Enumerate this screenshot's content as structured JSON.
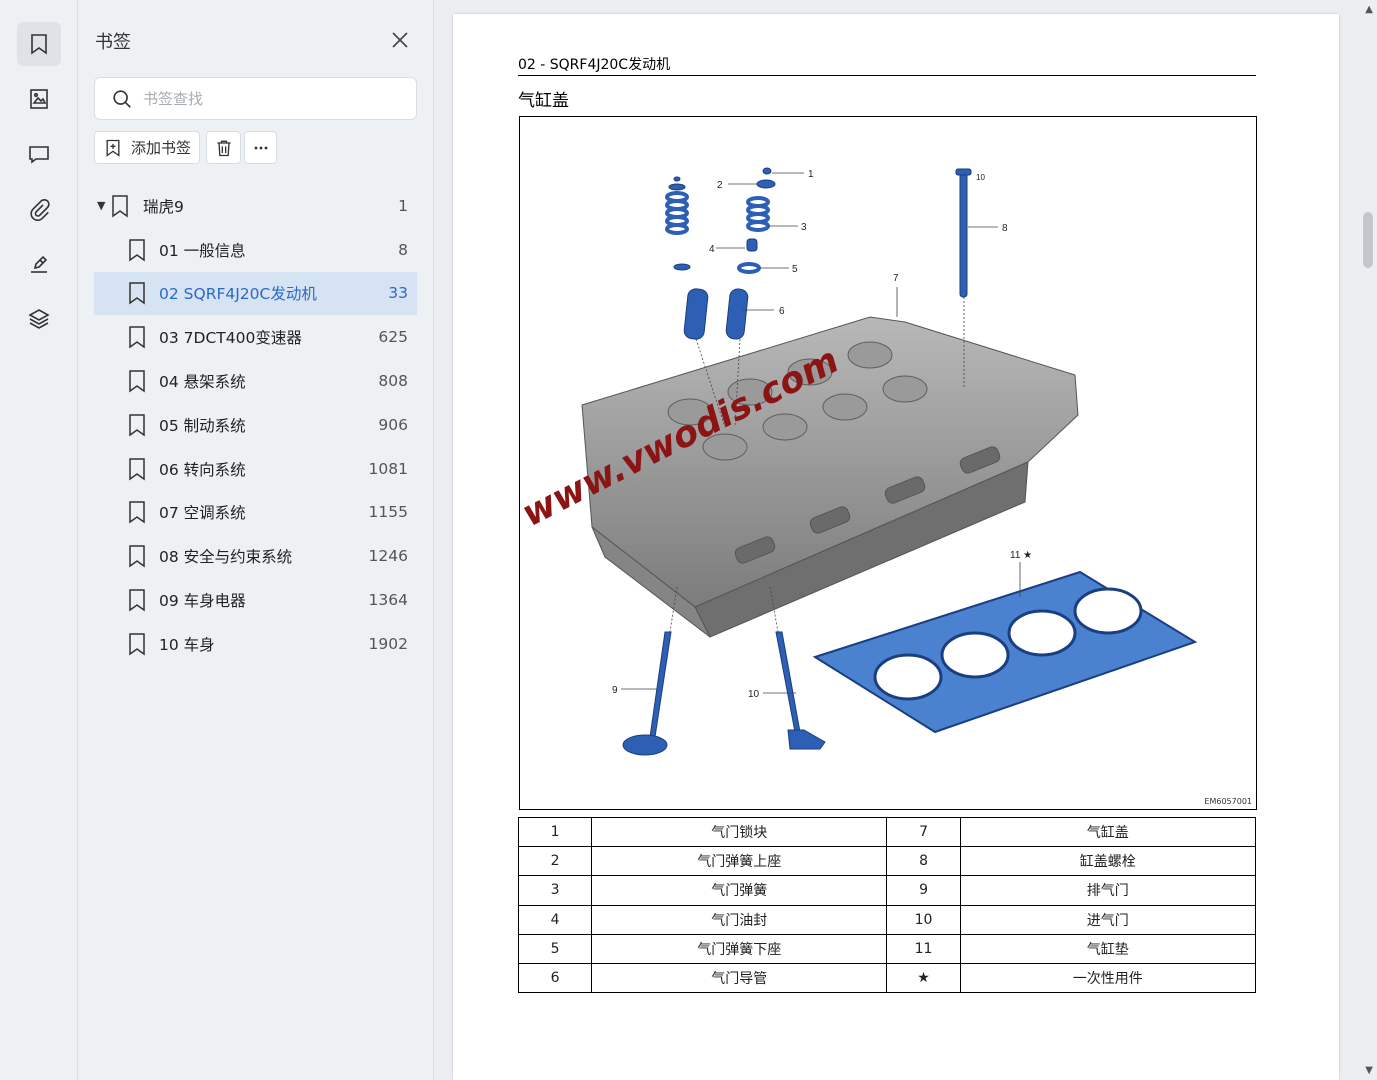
{
  "rail": {
    "icons": [
      "bookmark-icon",
      "thumbnail-icon",
      "comment-icon",
      "attachment-icon",
      "signature-icon",
      "layers-icon"
    ]
  },
  "panel": {
    "title": "书签",
    "search_placeholder": "书签查找",
    "add_label": "添加书签",
    "root": {
      "label": "瑞虎9",
      "page": "1"
    },
    "items": [
      {
        "label": "01 一般信息",
        "page": "8",
        "selected": false
      },
      {
        "label": "02 SQRF4J20C发动机",
        "page": "33",
        "selected": true
      },
      {
        "label": "03 7DCT400变速器",
        "page": "625",
        "selected": false
      },
      {
        "label": "04 悬架系统",
        "page": "808",
        "selected": false
      },
      {
        "label": "05 制动系统",
        "page": "906",
        "selected": false
      },
      {
        "label": "06 转向系统",
        "page": "1081",
        "selected": false
      },
      {
        "label": "07 空调系统",
        "page": "1155",
        "selected": false
      },
      {
        "label": "08 安全与约束系统",
        "page": "1246",
        "selected": false
      },
      {
        "label": "09 车身电器",
        "page": "1364",
        "selected": false
      },
      {
        "label": "10 车身",
        "page": "1902",
        "selected": false
      }
    ]
  },
  "doc": {
    "header": "02 - SQRF4J20C发动机",
    "title": "气缸盖",
    "figure_code": "EM6057001",
    "watermark": "www.vwodis.com",
    "callouts": [
      "1",
      "2",
      "3",
      "4",
      "5",
      "6",
      "7",
      "8",
      "9",
      "10",
      "10",
      "11 ★"
    ],
    "legend": [
      [
        "1",
        "气门锁块",
        "7",
        "气缸盖"
      ],
      [
        "2",
        "气门弹簧上座",
        "8",
        "缸盖螺栓"
      ],
      [
        "3",
        "气门弹簧",
        "9",
        "排气门"
      ],
      [
        "4",
        "气门油封",
        "10",
        "进气门"
      ],
      [
        "5",
        "气门弹簧下座",
        "11",
        "气缸垫"
      ],
      [
        "6",
        "气门导管",
        "★",
        "一次性用件"
      ]
    ]
  },
  "colors": {
    "accent": "#2a6ac7",
    "selection": "#d6e3f3",
    "part_blue": "#2d5fb5",
    "watermark": "#8b1414"
  }
}
